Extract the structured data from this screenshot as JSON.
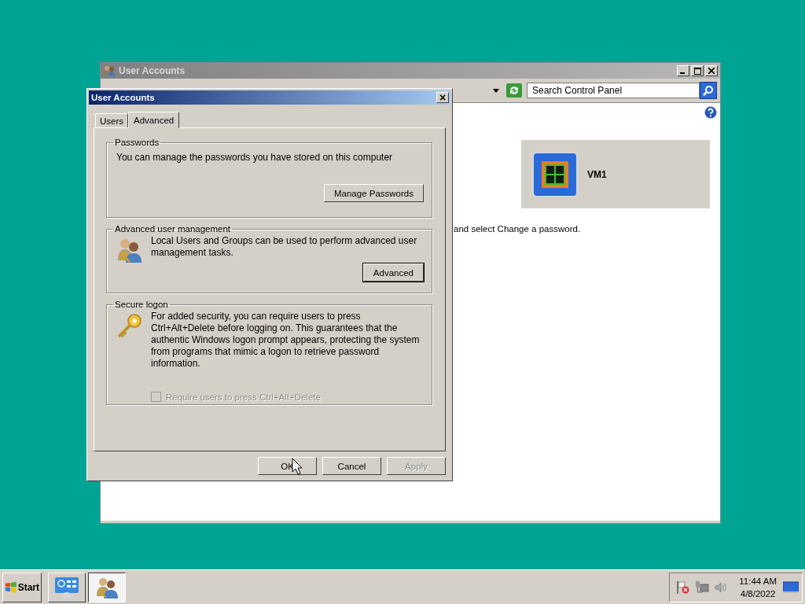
{
  "back_window": {
    "title": "User Accounts",
    "search": {
      "placeholder": "Search Control Panel"
    },
    "account": {
      "name": "VM1"
    },
    "hint": "and select Change a password."
  },
  "dialog": {
    "title": "User Accounts",
    "close": "×",
    "tabs": [
      {
        "label": "Users",
        "selected": false
      },
      {
        "label": "Advanced",
        "selected": true
      }
    ],
    "sections": [
      {
        "kind": "plain",
        "title": "Passwords",
        "text": "You can manage the passwords you have stored on this computer",
        "button": "Manage Passwords"
      },
      {
        "kind": "users",
        "title": "Advanced user management",
        "text": "Local Users and Groups can be used to perform advanced user management tasks.",
        "button": "Advanced"
      },
      {
        "kind": "key",
        "title": "Secure logon",
        "text": "For added security, you can require users to press Ctrl+Alt+Delete before logging on. This guarantees that the authentic Windows logon prompt appears, protecting the system from programs that mimic a logon to retrieve password information.",
        "checkbox": {
          "label": "Require users to press Ctrl+Alt+Delete",
          "checked": false,
          "disabled": true
        }
      }
    ],
    "buttons": [
      {
        "label": "OK",
        "disabled": false
      },
      {
        "label": "Cancel",
        "disabled": false
      },
      {
        "label": "Apply",
        "disabled": true
      }
    ]
  },
  "taskbar": {
    "start": "Start",
    "apps": [
      {
        "kind": "control-panel",
        "selected": false
      },
      {
        "kind": "users",
        "selected": true
      }
    ],
    "clock": {
      "time": "11:44 AM",
      "date": "4/8/2022"
    }
  }
}
